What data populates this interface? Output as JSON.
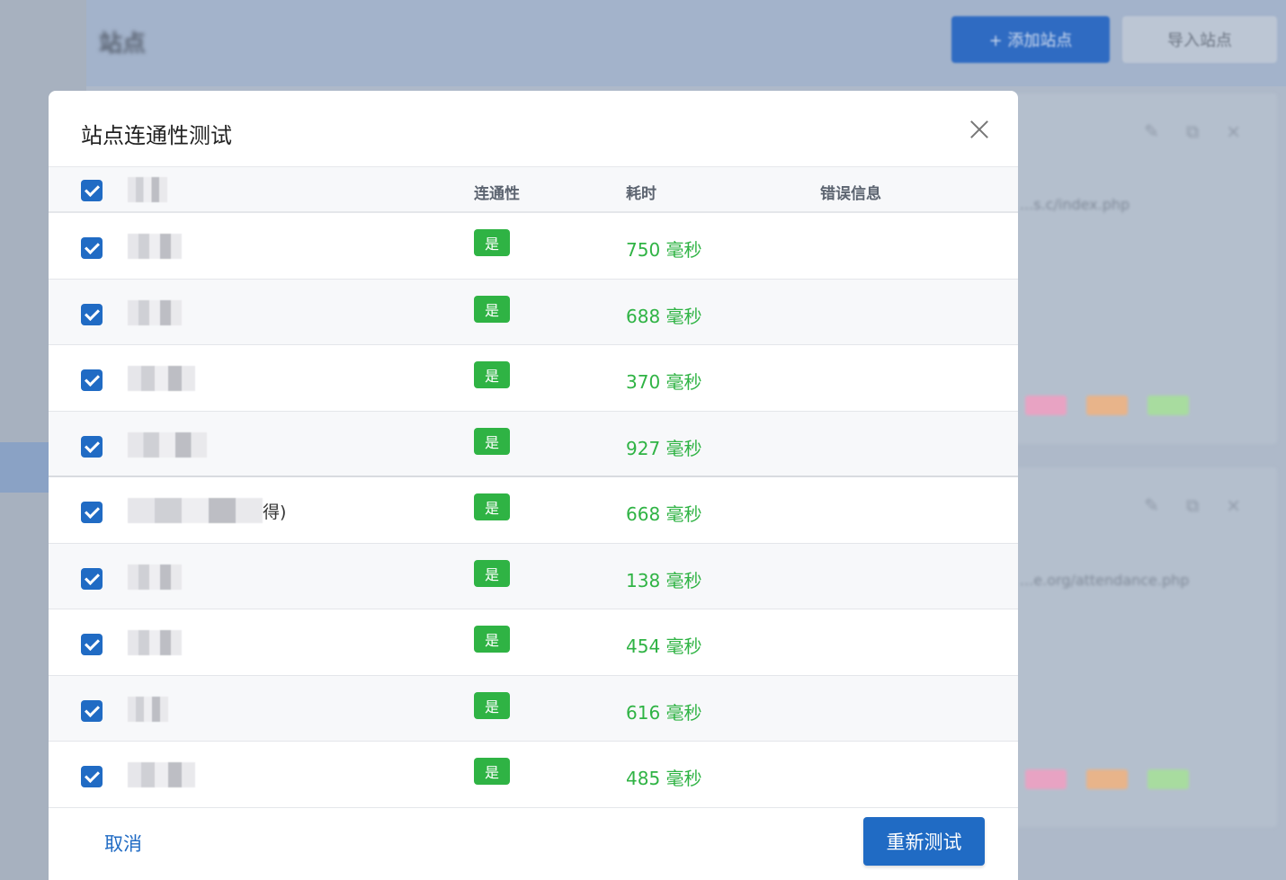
{
  "background": {
    "page_title": "站点",
    "add_button": "+ 添加站点",
    "secondary_button": "导入站点",
    "cards": [
      {
        "url": "...s.c/index.php"
      },
      {
        "url": "...e.org/attendance.php"
      }
    ],
    "tag_colors": [
      "#e8a3c3",
      "#e8b48a",
      "#a8dc9f"
    ]
  },
  "modal": {
    "title": "站点连通性测试",
    "columns": {
      "connectivity": "连通性",
      "time": "耗时",
      "error": "错误信息"
    },
    "rows": [
      {
        "site_suffix": "",
        "site_width": 60,
        "connected": "是",
        "time": "750 毫秒",
        "error": ""
      },
      {
        "site_suffix": "",
        "site_width": 60,
        "connected": "是",
        "time": "688 毫秒",
        "error": ""
      },
      {
        "site_suffix": "",
        "site_width": 75,
        "connected": "是",
        "time": "370 毫秒",
        "error": ""
      },
      {
        "site_suffix": "",
        "site_width": 88,
        "connected": "是",
        "time": "927 毫秒",
        "error": ""
      },
      {
        "site_suffix": "得)",
        "site_width": 150,
        "connected": "是",
        "time": "668 毫秒",
        "error": ""
      },
      {
        "site_suffix": "",
        "site_width": 60,
        "connected": "是",
        "time": "138 毫秒",
        "error": ""
      },
      {
        "site_suffix": "",
        "site_width": 60,
        "connected": "是",
        "time": "454 毫秒",
        "error": ""
      },
      {
        "site_suffix": "",
        "site_width": 45,
        "connected": "是",
        "time": "616 毫秒",
        "error": ""
      },
      {
        "site_suffix": "",
        "site_width": 75,
        "connected": "是",
        "time": "485 毫秒",
        "error": ""
      }
    ],
    "cancel_label": "取消",
    "retest_label": "重新测试"
  },
  "colors": {
    "primary": "#206bc4",
    "success": "#2fb344"
  }
}
